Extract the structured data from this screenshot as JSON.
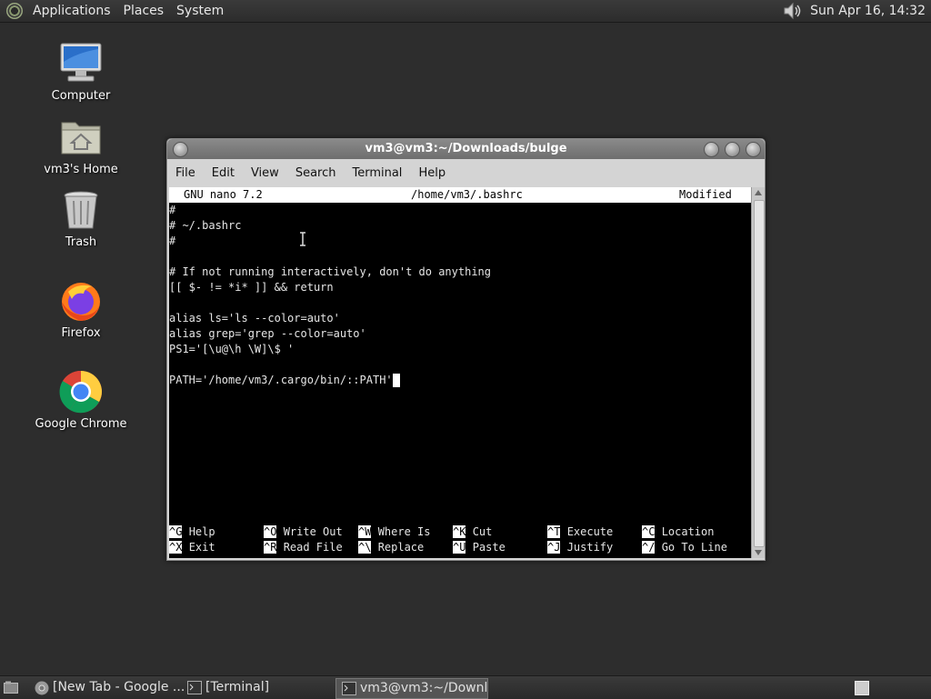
{
  "top_panel": {
    "menus": [
      "Applications",
      "Places",
      "System"
    ],
    "clock": "Sun Apr 16, 14:32"
  },
  "desktop": {
    "icons": [
      {
        "label": "Computer"
      },
      {
        "label": "vm3's Home"
      },
      {
        "label": "Trash"
      },
      {
        "label": "Firefox"
      },
      {
        "label": "Google Chrome"
      }
    ]
  },
  "window": {
    "title": "vm3@vm3:~/Downloads/bulge",
    "menus": [
      "File",
      "Edit",
      "View",
      "Search",
      "Terminal",
      "Help"
    ]
  },
  "nano": {
    "version": "GNU nano 7.2",
    "file": "/home/vm3/.bashrc",
    "status": "Modified",
    "lines": [
      "#",
      "# ~/.bashrc",
      "#",
      "",
      "# If not running interactively, don't do anything",
      "[[ $- != *i* ]] && return",
      "",
      "alias ls='ls --color=auto'",
      "alias grep='grep --color=auto'",
      "PS1='[\\u@\\h \\W]\\$ '",
      "",
      "PATH='/home/vm3/.cargo/bin/::PATH'"
    ],
    "shortcuts": [
      [
        {
          "key": "^G",
          "label": "Help"
        },
        {
          "key": "^X",
          "label": "Exit"
        }
      ],
      [
        {
          "key": "^O",
          "label": "Write Out"
        },
        {
          "key": "^R",
          "label": "Read File"
        }
      ],
      [
        {
          "key": "^W",
          "label": "Where Is"
        },
        {
          "key": "^\\",
          "label": "Replace"
        }
      ],
      [
        {
          "key": "^K",
          "label": "Cut"
        },
        {
          "key": "^U",
          "label": "Paste"
        }
      ],
      [
        {
          "key": "^T",
          "label": "Execute"
        },
        {
          "key": "^J",
          "label": "Justify"
        }
      ],
      [
        {
          "key": "^C",
          "label": "Location"
        },
        {
          "key": "^/",
          "label": "Go To Line"
        }
      ]
    ]
  },
  "taskbar": {
    "tasks": [
      {
        "label": "[New Tab - Google ..."
      },
      {
        "label": "[Terminal]"
      },
      {
        "label": "vm3@vm3:~/Downl..."
      }
    ]
  }
}
